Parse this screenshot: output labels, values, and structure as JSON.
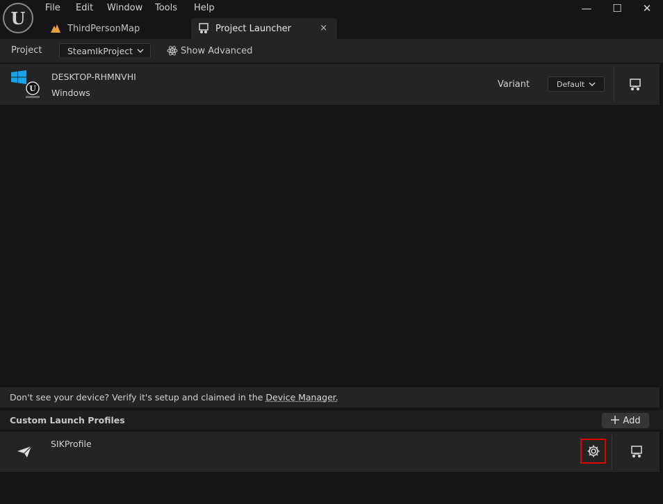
{
  "app": {
    "logo_glyph": "U",
    "menu": [
      "File",
      "Edit",
      "Window",
      "Tools",
      "Help"
    ],
    "window_controls": {
      "minimize": "—",
      "maximize": "☐",
      "close": "✕"
    }
  },
  "tabs": [
    {
      "label": "ThirdPersonMap",
      "icon": "level-icon",
      "active": false
    },
    {
      "label": "Project Launcher",
      "icon": "launcher-icon",
      "active": true,
      "close": "×"
    }
  ],
  "toolbar": {
    "project_label": "Project",
    "project_value": "SteamIkProject",
    "show_advanced": "Show Advanced"
  },
  "device": {
    "name": "DESKTOP-RHMNVHI",
    "platform": "Windows",
    "variant_label": "Variant",
    "variant_value": "Default"
  },
  "hint": {
    "text": "Don't see your device? Verify it's setup and claimed in the ",
    "link": "Device Manager."
  },
  "profiles": {
    "title": "Custom Launch Profiles",
    "add_label": "Add",
    "items": [
      {
        "name": "SIKProfile"
      }
    ]
  },
  "colors": {
    "accent_highlight": "#e00000",
    "windows_blue": "#1aa3e8",
    "level_icon": "#e8a33a"
  }
}
